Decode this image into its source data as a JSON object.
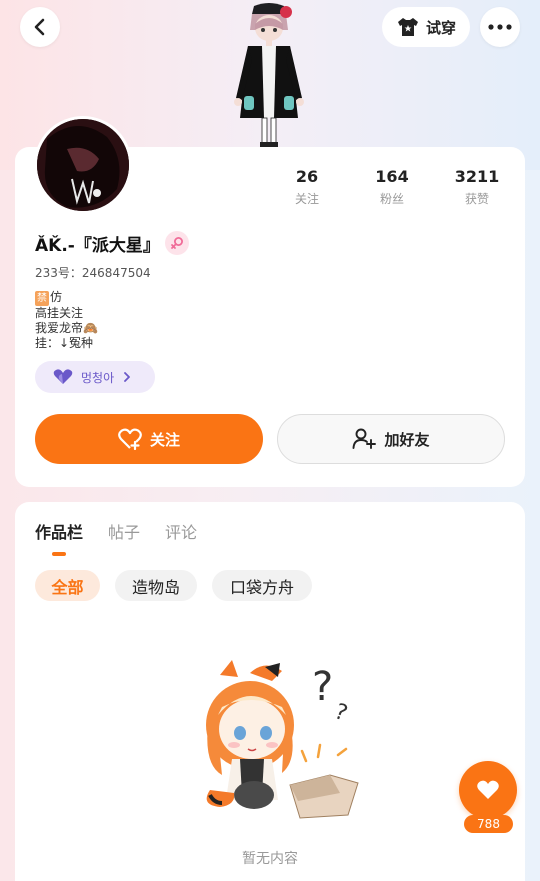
{
  "header": {
    "tryon_label": "试穿"
  },
  "profile": {
    "username": "ǍǨ.-『派大星』",
    "uid_label": "233号：",
    "uid_value": "246847504",
    "bio": {
      "ban_tag": "禁",
      "line1": "仿",
      "line2": "高挂关注",
      "line3": "我爱龙帝🙈",
      "line4": "挂：↓冤种"
    },
    "guild_name": "멍청아"
  },
  "stats": [
    {
      "value": "26",
      "label": "关注"
    },
    {
      "value": "164",
      "label": "粉丝"
    },
    {
      "value": "3211",
      "label": "获赞"
    }
  ],
  "actions": {
    "follow_label": "关注",
    "add_friend_label": "加好友"
  },
  "tabs": [
    {
      "label": "作品栏",
      "active": true
    },
    {
      "label": "帖子",
      "active": false
    },
    {
      "label": "评论",
      "active": false
    }
  ],
  "filters": [
    {
      "label": "全部",
      "active": true
    },
    {
      "label": "造物岛",
      "active": false
    },
    {
      "label": "口袋方舟",
      "active": false
    }
  ],
  "empty_text": "暂无内容",
  "like_count": "788",
  "colors": {
    "accent": "#fa7414",
    "guild_purple": "#6a58c9"
  }
}
